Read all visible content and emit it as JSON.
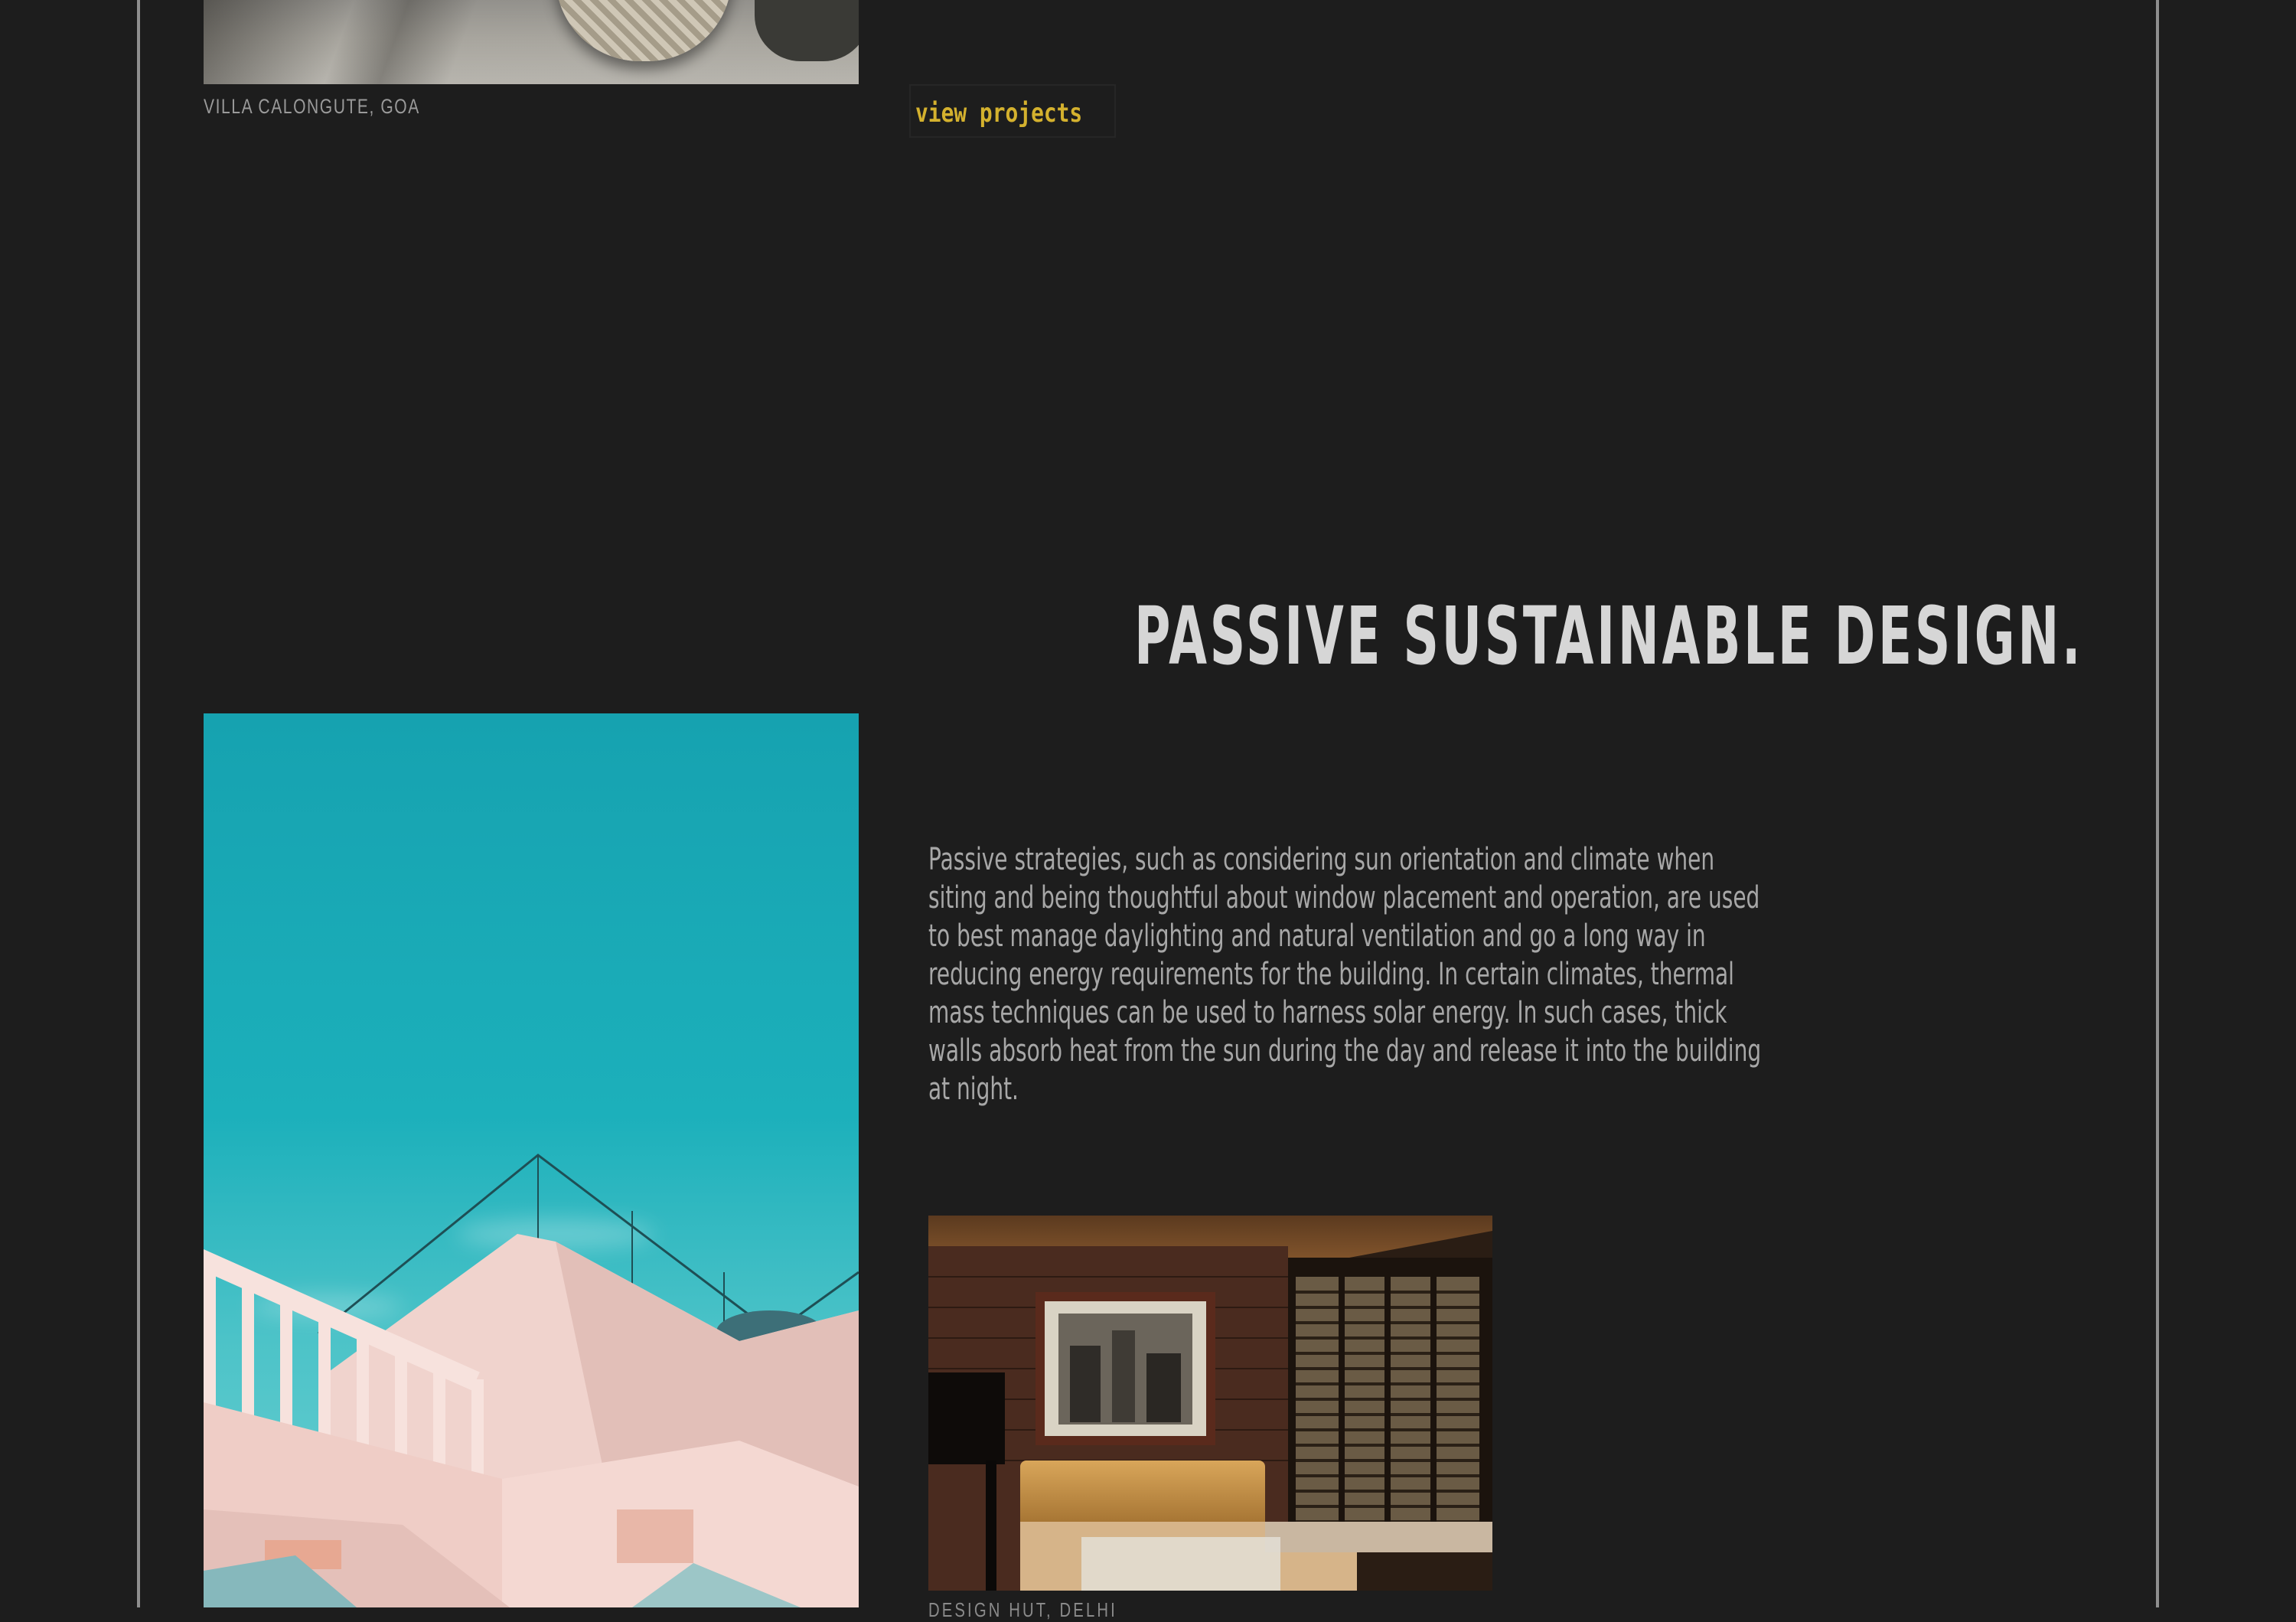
{
  "top_project": {
    "caption": "VILLA CALONGUTE, GOA",
    "button_label": "view projects"
  },
  "section": {
    "headline": "PASSIVE SUSTAINABLE DESIGN.",
    "body": "Passive strategies, such as considering sun orientation and climate when siting and being thoughtful about window placement and operation, are used to best manage daylighting and natural ventilation and go a long way in reducing energy requirements for the building. In certain climates, thermal mass techniques can be used to harness solar energy. In such cases, thick walls absorb heat from the sun during the day and release it into the building at night.",
    "featured_caption": "DESIGN HUT, DELHI"
  },
  "colors": {
    "background": "#1d1d1d",
    "frame": "#8e8e8e",
    "accent": "#d4b12e",
    "headline": "#d6d6d6",
    "body": "#a7a7a7"
  }
}
